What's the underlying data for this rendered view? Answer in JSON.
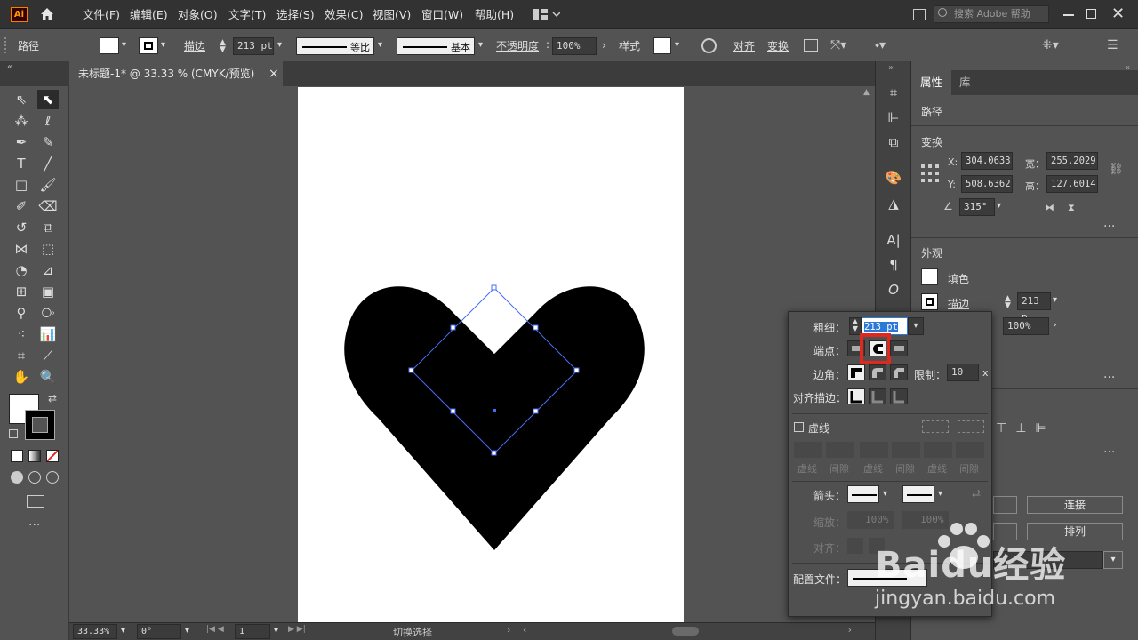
{
  "menubar": {
    "logo": "Ai",
    "items": [
      "文件(F)",
      "编辑(E)",
      "对象(O)",
      "文字(T)",
      "选择(S)",
      "效果(C)",
      "视图(V)",
      "窗口(W)",
      "帮助(H)"
    ],
    "search_placeholder": "搜索 Adobe 帮助"
  },
  "controlbar": {
    "selection_label": "路径",
    "stroke_label": "描边",
    "stroke_weight": "213 pt",
    "profile_label": "等比",
    "brush_label": "基本",
    "opacity_label": "不透明度",
    "opacity_value": "100%",
    "style_label": "样式",
    "align_label": "对齐",
    "transform_label": "变换"
  },
  "document_tab": {
    "title": "未标题-1* @ 33.33 % (CMYK/预览)",
    "close": "×"
  },
  "statusbar": {
    "zoom": "33.33%",
    "rotation": "0°",
    "artboard": "1",
    "tool_hint": "切换选择"
  },
  "properties_panel": {
    "tabs": [
      "属性",
      "库"
    ],
    "selection_type": "路径",
    "transform": {
      "title": "变换",
      "x_label": "X:",
      "x": "304.0633",
      "y_label": "Y:",
      "y": "508.6362",
      "w_label": "宽：",
      "w": "255.2029",
      "h_label": "高：",
      "h": "127.6014",
      "angle": "315°"
    },
    "appearance": {
      "title": "外观",
      "fill_label": "填色",
      "stroke_label": "描边",
      "stroke_value": "213 p",
      "opacity_value": "100%"
    },
    "buttons": {
      "join": "连接",
      "arrange": "排列"
    }
  },
  "stroke_popup": {
    "weight_label": "粗细：",
    "weight_value": "213 pt",
    "cap_label": "端点：",
    "corner_label": "边角：",
    "limit_label": "限制：",
    "limit_value": "10",
    "limit_unit": "x",
    "align_label": "对齐描边：",
    "dashed_label": "虚线",
    "dash_labels": [
      "虚线",
      "间隙",
      "虚线",
      "间隙",
      "虚线",
      "间隙"
    ],
    "arrow_label": "箭头：",
    "scale_label": "缩放：",
    "scale_value_1": "100%",
    "scale_value_2": "100%",
    "align_arrow_label": "对齐：",
    "profile_label": "配置文件："
  },
  "watermark": {
    "brand": "Baidu经验",
    "url": "jingyan.baidu.com"
  },
  "colors": {
    "accent_highlight": "#e0281e",
    "selection_blue": "#4a6cf0",
    "fill_black": "#000000"
  }
}
